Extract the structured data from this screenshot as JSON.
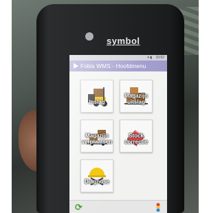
{
  "device": {
    "brand": "symbol"
  },
  "statusbar": {
    "time": "10:52",
    "signal": "▾ ▮"
  },
  "appbar": {
    "title": "Fobis WMS - Hoofdmenu"
  },
  "tiles": [
    {
      "label": "Inslag",
      "icon": "forklift-icon"
    },
    {
      "label": "Magazijn\nuitslag",
      "icon": "boxes-icon"
    },
    {
      "label": "Magazijn\nverplaatsen",
      "icon": "boxes-hand-icon"
    },
    {
      "label": "Stock\ncorrectie",
      "icon": "eraser-icon"
    },
    {
      "label": "Diagnose",
      "icon": "hardhat-tools-icon"
    }
  ],
  "bottombar": {
    "refresh_icon": "refresh-icon",
    "color_icon": "color-icon"
  },
  "colors": {
    "appbar": "#9b95c9",
    "screen": "#f2f3f1",
    "refresh": "#4c9c2c"
  }
}
